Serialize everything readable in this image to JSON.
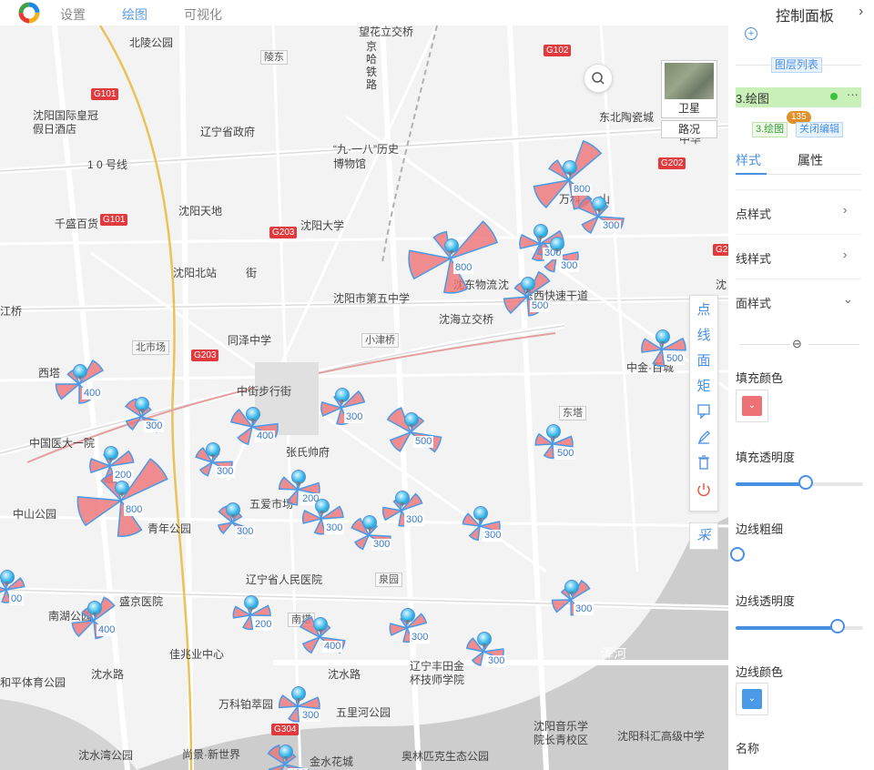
{
  "topbar": {
    "tabs": [
      {
        "label": "设置"
      },
      {
        "label": "绘图"
      },
      {
        "label": "可视化"
      }
    ],
    "active_tab": "绘图"
  },
  "map": {
    "labels": [
      {
        "text": "北陵公园"
      },
      {
        "text": "陵东"
      },
      {
        "text": "望花立交桥"
      },
      {
        "text": "京哈铁路"
      },
      {
        "text": "沈阳国际皇冠假日酒店"
      },
      {
        "text": "辽宁省政府"
      },
      {
        "text": "东北陶瓷城"
      },
      {
        "text": "中华"
      },
      {
        "text": "“九·一八”历史博物馆"
      },
      {
        "text": "1 0 号线"
      },
      {
        "text": "沈阳天地"
      },
      {
        "text": "千盛百货"
      },
      {
        "text": "沈阳大学"
      },
      {
        "text": "沈阳北站"
      },
      {
        "text": "街"
      },
      {
        "text": "沈东物流"
      },
      {
        "text": "沈海立交桥"
      },
      {
        "text": "东西快速干道"
      },
      {
        "text": "沈阳市第五中学"
      },
      {
        "text": "江桥"
      },
      {
        "text": "北市场"
      },
      {
        "text": "同泽中学"
      },
      {
        "text": "小津桥"
      },
      {
        "text": "中金·百城"
      },
      {
        "text": "西塔"
      },
      {
        "text": "中街步行街"
      },
      {
        "text": "东塔"
      },
      {
        "text": "中国医大一院"
      },
      {
        "text": "张氏帅府"
      },
      {
        "text": "五爱市场"
      },
      {
        "text": "中山公园"
      },
      {
        "text": "青年公园"
      },
      {
        "text": "辽宁省人民医院"
      },
      {
        "text": "泉园"
      },
      {
        "text": "盛京医院"
      },
      {
        "text": "南湖公园"
      },
      {
        "text": "南塔"
      },
      {
        "text": "佳兆业中心"
      },
      {
        "text": "辽宁丰田金杯技师学院"
      },
      {
        "text": "和平体育公园"
      },
      {
        "text": "沈水路"
      },
      {
        "text": "万科铂萃园"
      },
      {
        "text": "五里河公园"
      },
      {
        "text": "沈阳音乐学院长青校区"
      },
      {
        "text": "沈阳科汇高级中学"
      },
      {
        "text": "沈水湾公园"
      },
      {
        "text": "尚景·新世界"
      },
      {
        "text": "金水花城"
      },
      {
        "text": "奥林匹克生态公园"
      },
      {
        "text": "浑河"
      },
      {
        "text": "万科"
      },
      {
        "text": "山"
      },
      {
        "text": "沈"
      },
      {
        "text": "沈"
      },
      {
        "text": "沈水路"
      }
    ],
    "road_badges": [
      {
        "text": "G101"
      },
      {
        "text": "G101"
      },
      {
        "text": "G203"
      },
      {
        "text": "G203"
      },
      {
        "text": "G102"
      },
      {
        "text": "G202"
      },
      {
        "text": "G304"
      },
      {
        "text": "G2"
      }
    ],
    "markers": [
      {
        "value": "800"
      },
      {
        "value": "300"
      },
      {
        "value": "300"
      },
      {
        "value": "800"
      },
      {
        "value": "300"
      },
      {
        "value": "500"
      },
      {
        "value": "500"
      },
      {
        "value": "500"
      },
      {
        "value": "300"
      },
      {
        "value": "400"
      },
      {
        "value": "400"
      },
      {
        "value": "500"
      },
      {
        "value": "300"
      },
      {
        "value": "200"
      },
      {
        "value": "300"
      },
      {
        "value": "800"
      },
      {
        "value": "200"
      },
      {
        "value": "300"
      },
      {
        "value": "300"
      },
      {
        "value": "300"
      },
      {
        "value": "300"
      },
      {
        "value": "300"
      },
      {
        "value": "400"
      },
      {
        "value": "200"
      },
      {
        "value": "400"
      },
      {
        "value": "300"
      },
      {
        "value": "300"
      },
      {
        "value": "300"
      },
      {
        "value": "300"
      },
      {
        "value": "400"
      },
      {
        "value": "00"
      }
    ],
    "satellite_label": "卫星",
    "road_label": "路况"
  },
  "toolbar": {
    "items": [
      {
        "label": "点"
      },
      {
        "label": "线"
      },
      {
        "label": "面"
      },
      {
        "label": "矩"
      }
    ],
    "cai_label": "采"
  },
  "panel": {
    "title": "控制面板",
    "layer_list_label": "图层列表",
    "layer_name": "3.绘图",
    "layer_more": "···",
    "layer_tag": "3.绘图",
    "count": "135",
    "close_edit_label": "关闭编辑",
    "tabs": [
      {
        "label": "样式"
      },
      {
        "label": "属性"
      }
    ],
    "active_tab": "样式",
    "sections": [
      {
        "label": "点样式"
      },
      {
        "label": "线样式"
      },
      {
        "label": "面样式"
      }
    ],
    "fill_color_label": "填充颜色",
    "fill_color": "#ec7276",
    "fill_opacity_label": "填充透明度",
    "fill_opacity": 0.55,
    "border_width_label": "边线粗细",
    "border_width": 0,
    "border_opacity_label": "边线透明度",
    "border_opacity": 0.8,
    "border_color_label": "边线颜色",
    "border_color": "#4a9ae8",
    "name_label": "名称"
  }
}
